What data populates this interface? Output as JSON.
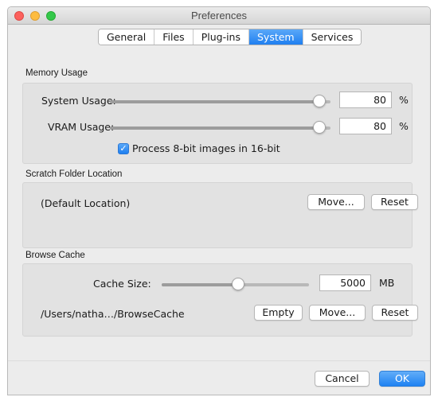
{
  "window": {
    "title": "Preferences"
  },
  "tabs": [
    {
      "label": "General",
      "active": false
    },
    {
      "label": "Files",
      "active": false
    },
    {
      "label": "Plug-ins",
      "active": false
    },
    {
      "label": "System",
      "active": true
    },
    {
      "label": "Services",
      "active": false
    }
  ],
  "memory": {
    "section_label": "Memory Usage",
    "system_usage": {
      "label": "System Usage:",
      "value": "80",
      "unit": "%",
      "slider_fraction": 0.95
    },
    "vram_usage": {
      "label": "VRAM Usage:",
      "value": "80",
      "unit": "%",
      "slider_fraction": 0.95
    },
    "process_checkbox": {
      "label": "Process 8-bit images in 16-bit",
      "checked": true
    }
  },
  "scratch": {
    "section_label": "Scratch Folder Location",
    "location": "(Default Location)",
    "move_label": "Move...",
    "reset_label": "Reset"
  },
  "browse_cache": {
    "section_label": "Browse Cache",
    "cache_size_label": "Cache Size:",
    "cache_size_value": "5000",
    "cache_size_unit": "MB",
    "slider_fraction": 0.52,
    "path": "/Users/natha…/BrowseCache",
    "empty_label": "Empty",
    "move_label": "Move...",
    "reset_label": "Reset"
  },
  "footer": {
    "cancel_label": "Cancel",
    "ok_label": "OK"
  },
  "colors": {
    "accent": "#1f7ff0",
    "window_bg": "#ececec",
    "group_bg": "#e2e2e2"
  }
}
